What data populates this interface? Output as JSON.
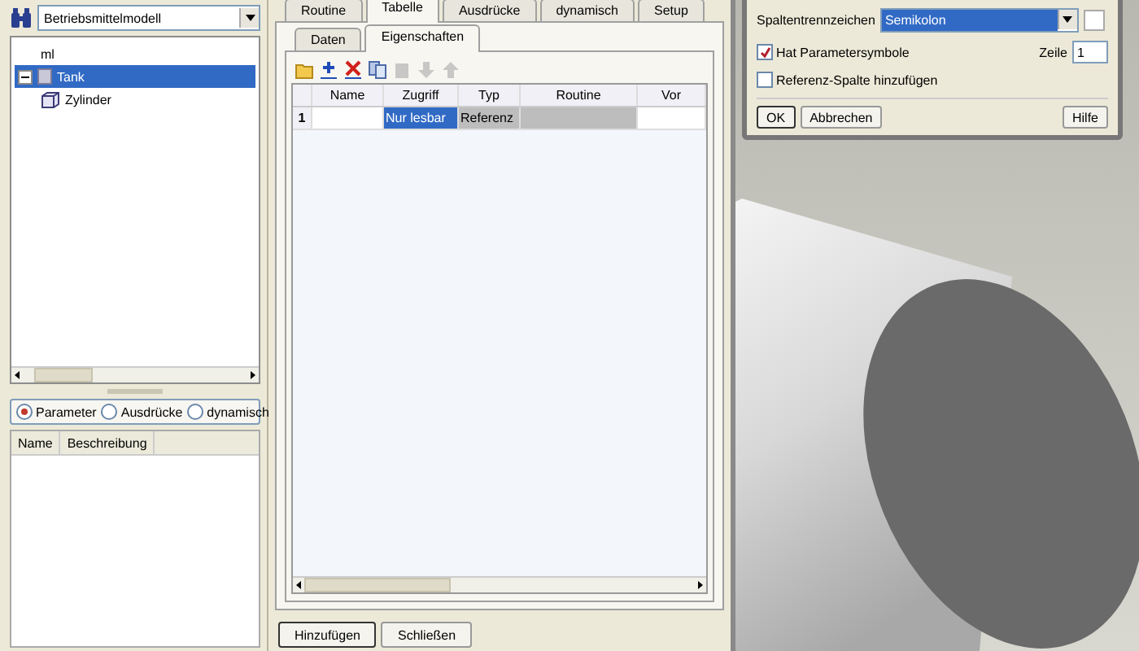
{
  "left_panel": {
    "model_select": {
      "value": "Betriebsmittelmodell"
    },
    "tree": {
      "root": "ml",
      "items": [
        {
          "label": "Tank",
          "kind": "assembly",
          "selected": true,
          "expanded": true,
          "children": [
            {
              "label": "Zylinder",
              "kind": "part",
              "selected": false
            }
          ]
        }
      ]
    },
    "radios": [
      {
        "label": "Parameter",
        "selected": true
      },
      {
        "label": "Ausdrücke",
        "selected": false
      },
      {
        "label": "dynamisch",
        "selected": false
      }
    ],
    "list_columns": [
      "Name",
      "Beschreibung"
    ]
  },
  "main_tabs": [
    {
      "label": "Routine",
      "selected": false
    },
    {
      "label": "Tabelle",
      "selected": true
    },
    {
      "label": "Ausdrücke",
      "selected": false
    },
    {
      "label": "dynamisch",
      "selected": false
    },
    {
      "label": "Setup",
      "selected": false
    }
  ],
  "sub_tabs": [
    {
      "label": "Daten",
      "selected": false
    },
    {
      "label": "Eigenschaften",
      "selected": true
    }
  ],
  "toolbar": [
    {
      "kind": "open",
      "disabled": false
    },
    {
      "kind": "add",
      "disabled": false
    },
    {
      "kind": "delete",
      "disabled": false
    },
    {
      "kind": "copy",
      "disabled": false
    },
    {
      "kind": "paste",
      "disabled": true
    },
    {
      "kind": "down",
      "disabled": true
    },
    {
      "kind": "up",
      "disabled": true
    }
  ],
  "table": {
    "columns": [
      "Name",
      "Zugriff",
      "Typ",
      "Routine",
      "Vor"
    ],
    "rows": [
      {
        "number": "1",
        "cells": [
          {
            "text": "",
            "selected": false,
            "disabled": false
          },
          {
            "text": "Nur lesbar",
            "selected": true,
            "disabled": false
          },
          {
            "text": "Referenz",
            "selected": false,
            "disabled": true
          },
          {
            "text": "",
            "selected": false,
            "disabled": true
          },
          {
            "text": "",
            "selected": false,
            "disabled": false
          }
        ]
      }
    ]
  },
  "buttons": [
    {
      "label": "Hinzufügen",
      "default": true
    },
    {
      "label": "Schließen",
      "default": false
    }
  ],
  "dialog": {
    "separator_label": "Spaltentrennzeichen",
    "separator_value": "Semikolon",
    "has_symbols": {
      "label": "Hat Parametersymbole",
      "checked": true
    },
    "row_label": "Zeile",
    "row_value": "1",
    "ref_column": {
      "label": "Referenz-Spalte hinzufügen",
      "checked": false
    },
    "buttons": [
      {
        "label": "OK",
        "default": true
      },
      {
        "label": "Abbrechen",
        "default": false
      },
      {
        "label": "Hilfe",
        "default": false
      }
    ]
  }
}
